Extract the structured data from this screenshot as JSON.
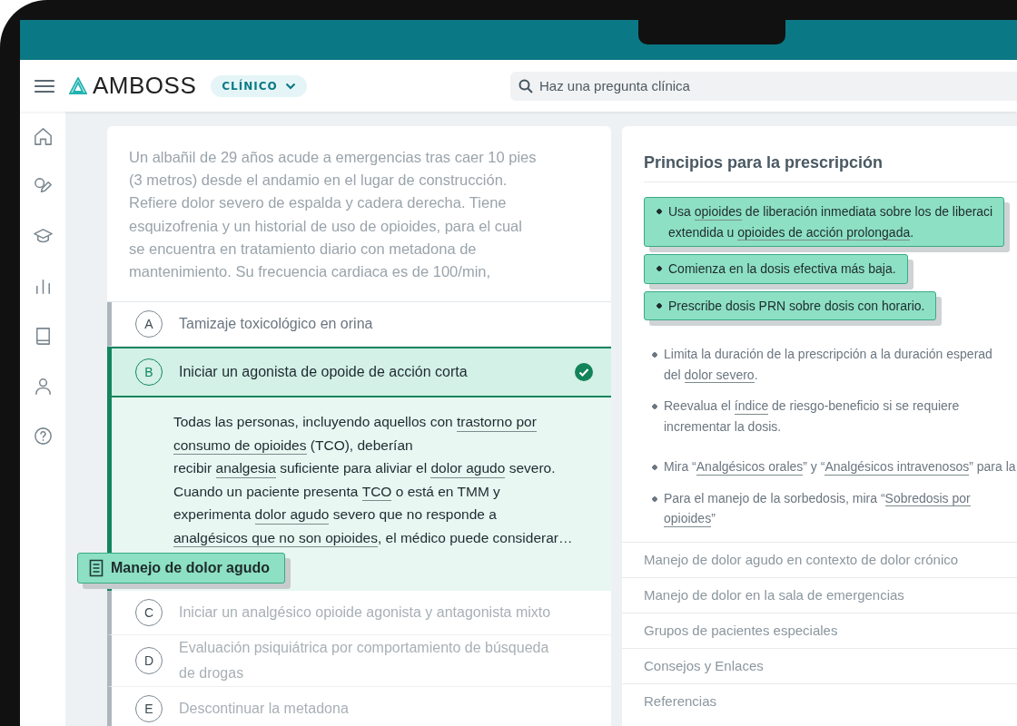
{
  "header": {
    "logo": "AMBOSS",
    "mode": "CLÍNICO",
    "search": {
      "placeholder": "Haz una pregunta clínica"
    }
  },
  "question": {
    "stem": [
      "Un albañil de 29 años acude a emergencias tras caer 10 pies",
      "(3 metros) desde el andamio en el lugar de construcción.",
      "Refiere dolor severo de espalda y cadera derecha.  Tiene",
      "esquizofrenia  y un historial de uso de opioides, para el cual",
      "se encuentra en tratamiento diario con metadona de",
      "mantenimiento. Su frecuencia cardiaca es de 100/min,"
    ],
    "options": [
      {
        "letter": "A",
        "text": "Tamizaje toxicológico en orina",
        "selected": false,
        "correct": false,
        "dimmed": false
      },
      {
        "letter": "B",
        "text": "Iniciar un agonista de opoide de acción corta",
        "selected": true,
        "correct": true,
        "dimmed": false
      },
      {
        "letter": "C",
        "text": "Iniciar un analgésico opioide agonista y antagonista mixto",
        "selected": false,
        "correct": false,
        "dimmed": true
      },
      {
        "letter": "D",
        "text": "Evaluación psiquiátrica por comportamiento de búsqueda de drogas",
        "selected": false,
        "correct": false,
        "dimmed": true
      },
      {
        "letter": "E",
        "text": "Descontinuar la metadona",
        "selected": false,
        "correct": false,
        "dimmed": true
      }
    ],
    "explanation": [
      [
        {
          "text": "Todas las personas, incluyendo aquellos con ",
          "link": false
        },
        {
          "text": "trastorno por",
          "link": true
        }
      ],
      [
        {
          "text": "consumo de opioides",
          "link": true
        },
        {
          "text": " (TCO), deberían",
          "link": false
        }
      ],
      [
        {
          "text": "recibir ",
          "link": false
        },
        {
          "text": "analgesia",
          "link": true
        },
        {
          "text": " suficiente para aliviar el ",
          "link": false
        },
        {
          "text": "dolor agudo",
          "link": true
        },
        {
          "text": " severo.",
          "link": false
        }
      ],
      [
        {
          "text": "Cuando un paciente presenta ",
          "link": false
        },
        {
          "text": "TCO",
          "link": true
        },
        {
          "text": " o está en TMM y",
          "link": false
        }
      ],
      [
        {
          "text": "experimenta ",
          "link": false
        },
        {
          "text": "dolor agudo",
          "link": true
        },
        {
          "text": " severo que no responde a",
          "link": false
        }
      ],
      [
        {
          "text": "analgésicos que no son opioides",
          "link": true
        },
        {
          "text": ", el médico puede considerar…",
          "link": false
        }
      ]
    ],
    "article_tag": "Manejo de dolor agudo"
  },
  "article": {
    "title": "Principios para la prescripción",
    "bullets": [
      {
        "highlighted": true,
        "lines": [
          [
            {
              "text": "Usa ",
              "link": false
            },
            {
              "text": "opioides",
              "link": true
            },
            {
              "text": " de liberación inmediata sobre los de liberaci",
              "link": false
            }
          ],
          [
            {
              "text": "extendida u ",
              "link": false
            },
            {
              "text": "opioides de acción prolongada",
              "link": true
            },
            {
              "text": ".",
              "link": false
            }
          ]
        ]
      },
      {
        "highlighted": true,
        "lines": [
          [
            {
              "text": "Comienza en la dosis efectiva más baja.",
              "link": false
            }
          ]
        ]
      },
      {
        "highlighted": true,
        "lines": [
          [
            {
              "text": "Prescribe dosis PRN sobre dosis con horario.",
              "link": false
            }
          ]
        ]
      },
      {
        "highlighted": false,
        "lines": [
          [
            {
              "text": "Limita la duración de la prescripción a la duración esperad",
              "link": false
            }
          ],
          [
            {
              "text": "del ",
              "link": false
            },
            {
              "text": "dolor severo",
              "link": true
            },
            {
              "text": ".",
              "link": false
            }
          ]
        ]
      },
      {
        "highlighted": false,
        "lines": [
          [
            {
              "text": "Reevalua el ",
              "link": false
            },
            {
              "text": "índice",
              "link": true
            },
            {
              "text": " de riesgo-beneficio si se requiere",
              "link": false
            }
          ],
          [
            {
              "text": "incrementar la dosis.",
              "link": false
            }
          ]
        ]
      },
      {
        "highlighted": false,
        "lines": [
          [
            {
              "text": "Mira “",
              "link": false
            },
            {
              "text": "Analgésicos orales",
              "link": true
            },
            {
              "text": "” y “",
              "link": false
            },
            {
              "text": "Analgésicos intravenosos",
              "link": true
            },
            {
              "text": "” para la",
              "link": false
            }
          ]
        ]
      },
      {
        "highlighted": false,
        "lines": [
          [
            {
              "text": "Para el manejo de la sorbedosis, mira “",
              "link": false
            },
            {
              "text": "Sobredosis por",
              "link": true
            }
          ],
          [
            {
              "text": "opioides",
              "link": true
            },
            {
              "text": "”",
              "link": false
            }
          ]
        ]
      }
    ],
    "sections": [
      "Manejo de dolor agudo en contexto de dolor crónico",
      "Manejo de dolor en la sala de emergencias",
      "Grupos de pacientes especiales",
      "Consejos y Enlaces",
      "Referencias"
    ]
  }
}
